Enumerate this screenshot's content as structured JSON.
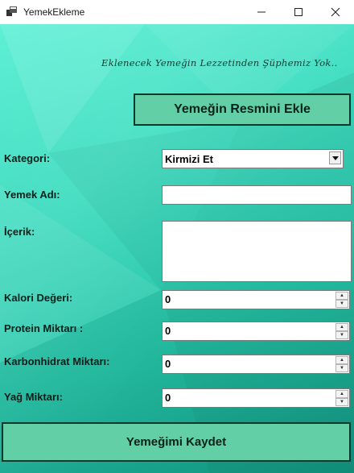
{
  "window": {
    "title": "YemekEkleme"
  },
  "slogan": "Eklenecek Yemeğin Lezzetinden Şüphemiz Yok..",
  "buttons": {
    "add_image": "Yemeğin Resmini Ekle",
    "save": "Yemeğimi Kaydet"
  },
  "form": {
    "category": {
      "label": "Kategori:",
      "value": "Kirmizi Et"
    },
    "name": {
      "label": "Yemek Adı:",
      "value": ""
    },
    "content": {
      "label": "İçerik:",
      "value": ""
    },
    "calorie": {
      "label": "Kalori Değeri:",
      "value": "0"
    },
    "protein": {
      "label": "Protein Miktarı :",
      "value": "0"
    },
    "carb": {
      "label": "Karbonhidrat Miktarı:",
      "value": "0"
    },
    "fat": {
      "label": "Yağ Miktarı:",
      "value": "0"
    }
  },
  "colors": {
    "background_top": "#5ef0d6",
    "background_bottom": "#129a85",
    "button_fill": "#62cfa6"
  }
}
